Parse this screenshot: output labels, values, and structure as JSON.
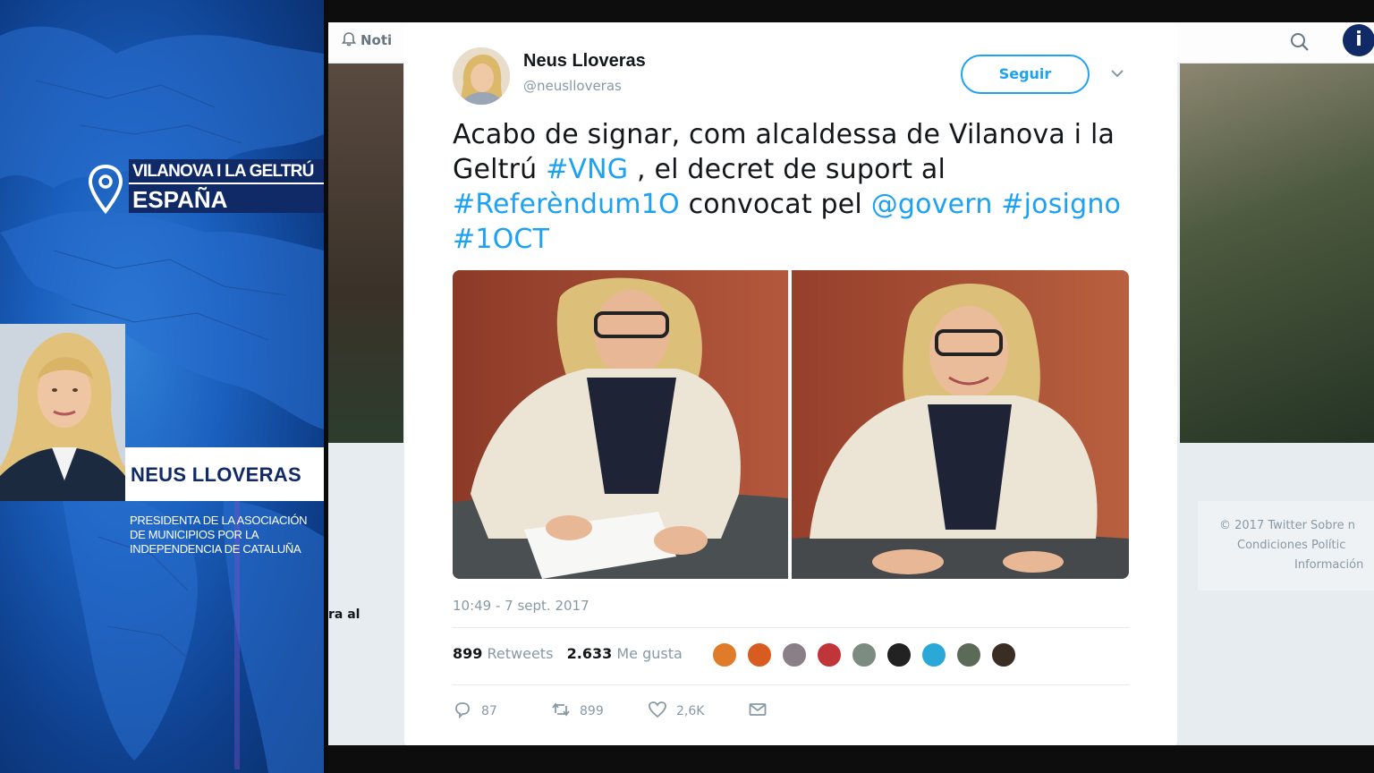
{
  "broadcast": {
    "location_city": "VILANOVA I LA GELTRÚ",
    "location_country": "ESPAÑA",
    "guest_name": "NEUS LLOVERAS",
    "guest_role_lines": [
      "PRESIDENTA DE LA ASOCIACIÓN",
      "DE MUNICIPIOS POR LA",
      "INDEPENDENCIA DE CATALUÑA"
    ],
    "channel_logo": "i"
  },
  "twitter_page": {
    "notifications_label": "Noti",
    "footer_lines": [
      "© 2017 Twitter   Sobre n",
      "Condiciones   Polític",
      "Información"
    ],
    "left_snippet": "ra al"
  },
  "tweet": {
    "author_name": "Neus Lloveras",
    "author_handle": "@neuslloveras",
    "follow_label": "Seguir",
    "text_segments": [
      {
        "t": "Acabo de signar, com alcaldessa de Vilanova i la Geltrú ",
        "tag": false
      },
      {
        "t": "#VNG",
        "tag": true
      },
      {
        "t": " , el decret de suport al ",
        "tag": false
      },
      {
        "t": "#Referèndum1O",
        "tag": true
      },
      {
        "t": " convocat pel ",
        "tag": false
      },
      {
        "t": "@govern",
        "tag": true
      },
      {
        "t": " ",
        "tag": false
      },
      {
        "t": "#josigno",
        "tag": true
      },
      {
        "t": " ",
        "tag": false
      },
      {
        "t": "#1OCT",
        "tag": true
      }
    ],
    "timestamp": "10:49 - 7 sept. 2017",
    "retweets_count": "899",
    "retweets_label": "Retweets",
    "likes_count": "2.633",
    "likes_label": "Me gusta",
    "actions": {
      "reply_count": "87",
      "retweet_count": "899",
      "like_count": "2,6K"
    },
    "liker_colors": [
      "#e07b2a",
      "#d85b1f",
      "#8a7f86",
      "#c0353a",
      "#7d8c80",
      "#222222",
      "#2aa8d8",
      "#5c6b58",
      "#3a2e24"
    ]
  }
}
